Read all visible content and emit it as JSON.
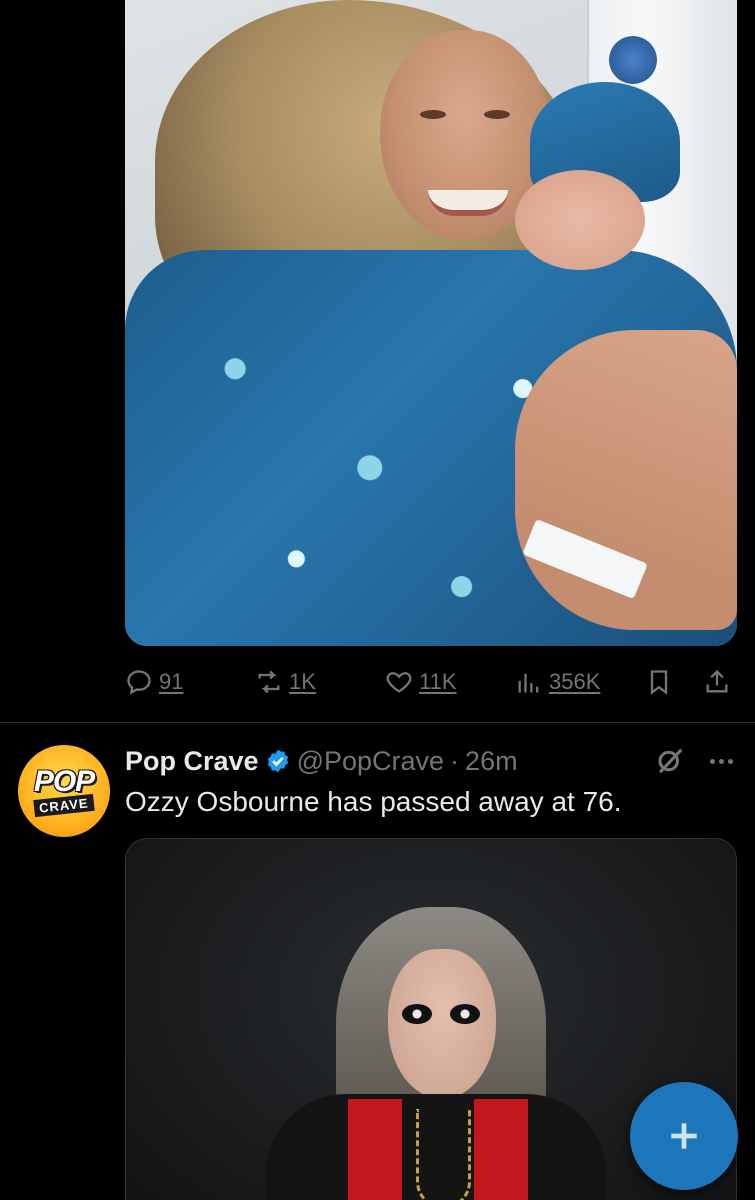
{
  "tweet1": {
    "media": {
      "type": "photo"
    },
    "actions": {
      "replies": "91",
      "retweets": "1K",
      "likes": "11K",
      "views": "356K"
    }
  },
  "tweet2": {
    "author": {
      "name": "Pop Crave",
      "verified": true,
      "handle": "@PopCrave"
    },
    "separator": "·",
    "time": "26m",
    "text": "Ozzy Osbourne has passed away at 76.",
    "avatar": {
      "line1": "POP",
      "line2": "CRAVE"
    },
    "media": {
      "type": "photo"
    }
  },
  "icons": {
    "reply": "reply-icon",
    "retweet": "retweet-icon",
    "like": "heart-icon",
    "views": "views-icon",
    "bookmark": "bookmark-icon",
    "share": "share-icon",
    "grok": "grok-icon",
    "more": "more-icon",
    "compose": "plus-icon",
    "verified": "verified-badge-icon"
  },
  "colors": {
    "background": "#000000",
    "text_primary": "#e7e9ea",
    "text_secondary": "#71767b",
    "verified": "#1d9bf0",
    "fab": "#1d76ba",
    "divider": "#2f3336"
  }
}
